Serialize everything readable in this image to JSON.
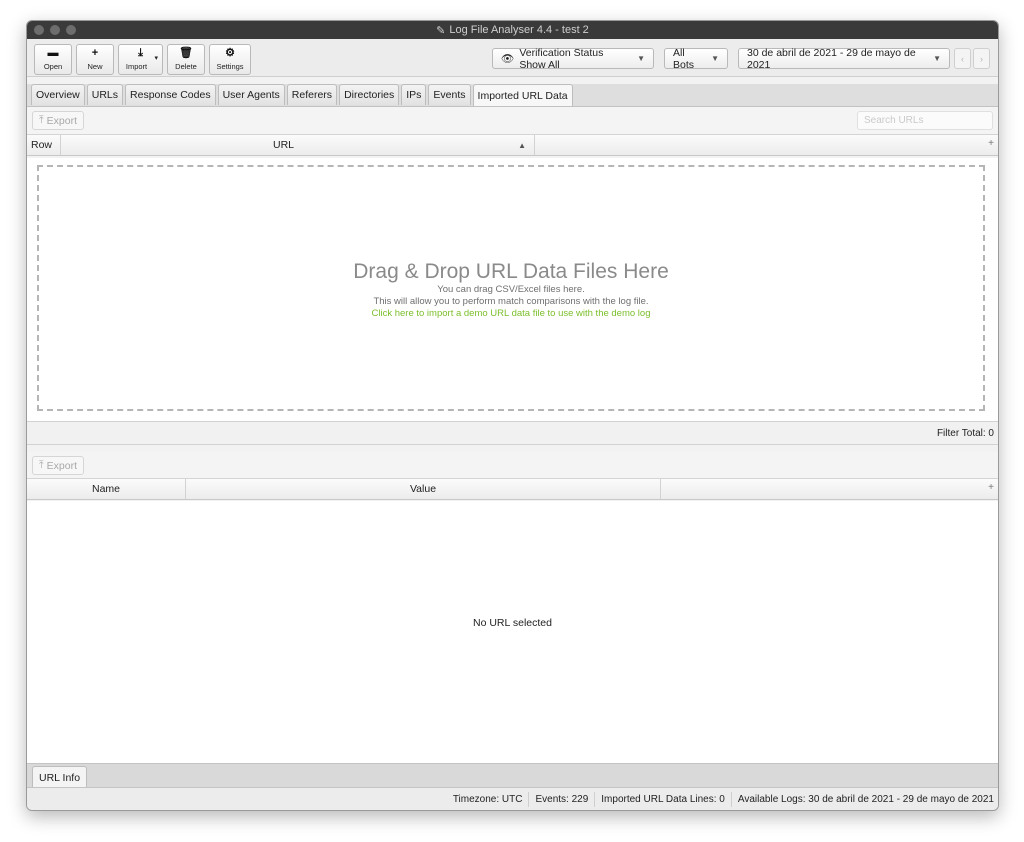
{
  "window": {
    "title": "Log File Analyser 4.4 - test 2"
  },
  "toolbar": {
    "buttons": [
      {
        "label": "Open",
        "icon": "folder-icon"
      },
      {
        "label": "New",
        "icon": "plus-icon"
      },
      {
        "label": "Import",
        "icon": "download-icon"
      },
      {
        "label": "Delete",
        "icon": "trash-icon"
      },
      {
        "label": "Settings",
        "icon": "gear-icon"
      }
    ],
    "verification": "Verification Status Show All",
    "bots": "All Bots",
    "date_range": "30 de abril de 2021 - 29 de mayo de 2021"
  },
  "tabs": [
    {
      "label": "Overview"
    },
    {
      "label": "URLs"
    },
    {
      "label": "Response Codes"
    },
    {
      "label": "User Agents"
    },
    {
      "label": "Referers"
    },
    {
      "label": "Directories"
    },
    {
      "label": "IPs"
    },
    {
      "label": "Events"
    },
    {
      "label": "Imported URL Data",
      "active": true
    }
  ],
  "upper": {
    "export_label": "Export",
    "search_placeholder": "Search URLs",
    "columns": [
      "Row",
      "URL"
    ],
    "drop": {
      "title": "Drag & Drop URL Data Files Here",
      "line1": "You can drag CSV/Excel files here.",
      "line2": "This will allow you to perform match comparisons with the log file.",
      "link": "Click here to import a demo URL data file to use with the demo log"
    },
    "filter_total": "Filter Total: 0"
  },
  "lower": {
    "export_label": "Export",
    "columns": [
      "Name",
      "Value"
    ],
    "empty_message": "No URL selected",
    "tab": "URL Info"
  },
  "status": {
    "timezone": "Timezone:  UTC",
    "events": "Events:  229",
    "imported_lines": "Imported URL Data Lines:  0",
    "available_logs": "Available Logs:  30 de abril de 2021 - 29 de mayo de 2021"
  },
  "colors": {
    "link_green": "#7bbf2a",
    "titlebar": "#3a3a3a"
  }
}
